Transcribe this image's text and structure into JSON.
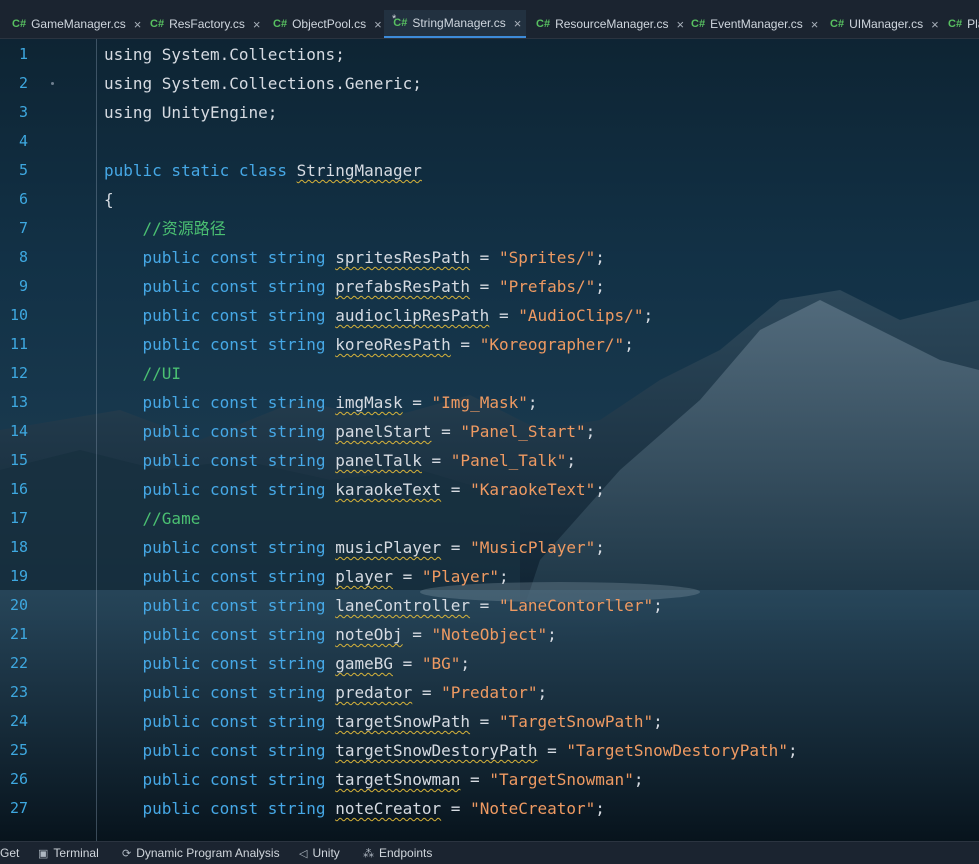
{
  "tabs": [
    {
      "label": "GameManager.cs",
      "lang": "C#",
      "active": false,
      "modified": false
    },
    {
      "label": "ResFactory.cs",
      "lang": "C#",
      "active": false,
      "modified": false
    },
    {
      "label": "ObjectPool.cs",
      "lang": "C#",
      "active": false,
      "modified": false
    },
    {
      "label": "StringManager.cs",
      "lang": "C#",
      "active": true,
      "modified": true
    },
    {
      "label": "ResourceManager.cs",
      "lang": "C#",
      "active": false,
      "modified": false
    },
    {
      "label": "EventManager.cs",
      "lang": "C#",
      "active": false,
      "modified": false
    },
    {
      "label": "UIManager.cs",
      "lang": "C#",
      "active": false,
      "modified": false
    },
    {
      "label": "Pla",
      "lang": "C#",
      "active": false,
      "modified": false
    }
  ],
  "tab_close_glyph": "×",
  "tab_modified_glyph": "*",
  "editor": {
    "lines": [
      {
        "n": "1",
        "tokens": [
          [
            "kw0",
            "using System.Collections;"
          ]
        ]
      },
      {
        "n": "2",
        "tokens": [
          [
            "pl",
            "using System.Collections.Generic;"
          ]
        ]
      },
      {
        "n": "3",
        "tokens": [
          [
            "pl",
            "using UnityEngine;"
          ]
        ]
      },
      {
        "n": "4",
        "tokens": []
      },
      {
        "n": "5",
        "tokens": [
          [
            "kw",
            "public static class "
          ],
          [
            "id",
            "StringManager"
          ]
        ]
      },
      {
        "n": "6",
        "tokens": [
          [
            "pl",
            "{"
          ]
        ]
      },
      {
        "n": "7",
        "tokens": [
          [
            "pl",
            "    "
          ],
          [
            "cm",
            "//资源路径"
          ]
        ]
      },
      {
        "n": "8",
        "tokens": [
          [
            "pl",
            "    "
          ],
          [
            "kw",
            "public const string "
          ],
          [
            "id",
            "spritesResPath"
          ],
          [
            "pl",
            " = "
          ],
          [
            "st",
            "\"Sprites/\""
          ],
          [
            "pl",
            ";"
          ]
        ]
      },
      {
        "n": "9",
        "tokens": [
          [
            "pl",
            "    "
          ],
          [
            "kw",
            "public const string "
          ],
          [
            "id",
            "prefabsResPath"
          ],
          [
            "pl",
            " = "
          ],
          [
            "st",
            "\"Prefabs/\""
          ],
          [
            "pl",
            ";"
          ]
        ]
      },
      {
        "n": "10",
        "tokens": [
          [
            "pl",
            "    "
          ],
          [
            "kw",
            "public const string "
          ],
          [
            "id",
            "audioclipResPath"
          ],
          [
            "pl",
            " = "
          ],
          [
            "st",
            "\"AudioClips/\""
          ],
          [
            "pl",
            ";"
          ]
        ]
      },
      {
        "n": "11",
        "tokens": [
          [
            "pl",
            "    "
          ],
          [
            "kw",
            "public const string "
          ],
          [
            "id",
            "koreoResPath"
          ],
          [
            "pl",
            " = "
          ],
          [
            "st",
            "\"Koreographer/\""
          ],
          [
            "pl",
            ";"
          ]
        ]
      },
      {
        "n": "12",
        "tokens": [
          [
            "pl",
            "    "
          ],
          [
            "cm",
            "//UI"
          ]
        ]
      },
      {
        "n": "13",
        "tokens": [
          [
            "pl",
            "    "
          ],
          [
            "kw",
            "public const string "
          ],
          [
            "id",
            "imgMask"
          ],
          [
            "pl",
            " = "
          ],
          [
            "st",
            "\"Img_Mask\""
          ],
          [
            "pl",
            ";"
          ]
        ]
      },
      {
        "n": "14",
        "tokens": [
          [
            "pl",
            "    "
          ],
          [
            "kw",
            "public const string "
          ],
          [
            "id",
            "panelStart"
          ],
          [
            "pl",
            " = "
          ],
          [
            "st",
            "\"Panel_Start\""
          ],
          [
            "pl",
            ";"
          ]
        ]
      },
      {
        "n": "15",
        "tokens": [
          [
            "pl",
            "    "
          ],
          [
            "kw",
            "public const string "
          ],
          [
            "id",
            "panelTalk"
          ],
          [
            "pl",
            " = "
          ],
          [
            "st",
            "\"Panel_Talk\""
          ],
          [
            "pl",
            ";"
          ]
        ]
      },
      {
        "n": "16",
        "tokens": [
          [
            "pl",
            "    "
          ],
          [
            "kw",
            "public const string "
          ],
          [
            "id",
            "karaokeText"
          ],
          [
            "pl",
            " = "
          ],
          [
            "st",
            "\"KaraokeText\""
          ],
          [
            "pl",
            ";"
          ]
        ]
      },
      {
        "n": "17",
        "tokens": [
          [
            "pl",
            "    "
          ],
          [
            "cm",
            "//Game"
          ]
        ]
      },
      {
        "n": "18",
        "tokens": [
          [
            "pl",
            "    "
          ],
          [
            "kw",
            "public const string "
          ],
          [
            "id",
            "musicPlayer"
          ],
          [
            "pl",
            " = "
          ],
          [
            "st",
            "\"MusicPlayer\""
          ],
          [
            "pl",
            ";"
          ]
        ]
      },
      {
        "n": "19",
        "tokens": [
          [
            "pl",
            "    "
          ],
          [
            "kw",
            "public const string "
          ],
          [
            "id",
            "player"
          ],
          [
            "pl",
            " = "
          ],
          [
            "st",
            "\"Player\""
          ],
          [
            "pl",
            ";"
          ]
        ]
      },
      {
        "n": "20",
        "tokens": [
          [
            "pl",
            "    "
          ],
          [
            "kw",
            "public const string "
          ],
          [
            "id",
            "laneController"
          ],
          [
            "pl",
            " = "
          ],
          [
            "st",
            "\"LaneContorller\""
          ],
          [
            "pl",
            ";"
          ]
        ]
      },
      {
        "n": "21",
        "tokens": [
          [
            "pl",
            "    "
          ],
          [
            "kw",
            "public const string "
          ],
          [
            "id",
            "noteObj"
          ],
          [
            "pl",
            " = "
          ],
          [
            "st",
            "\"NoteObject\""
          ],
          [
            "pl",
            ";"
          ]
        ]
      },
      {
        "n": "22",
        "tokens": [
          [
            "pl",
            "    "
          ],
          [
            "kw",
            "public const string "
          ],
          [
            "id",
            "gameBG"
          ],
          [
            "pl",
            " = "
          ],
          [
            "st",
            "\"BG\""
          ],
          [
            "pl",
            ";"
          ]
        ]
      },
      {
        "n": "23",
        "tokens": [
          [
            "pl",
            "    "
          ],
          [
            "kw",
            "public const string "
          ],
          [
            "id",
            "predator"
          ],
          [
            "pl",
            " = "
          ],
          [
            "st",
            "\"Predator\""
          ],
          [
            "pl",
            ";"
          ]
        ]
      },
      {
        "n": "24",
        "tokens": [
          [
            "pl",
            "    "
          ],
          [
            "kw",
            "public const string "
          ],
          [
            "id",
            "targetSnowPath"
          ],
          [
            "pl",
            " = "
          ],
          [
            "st",
            "\"TargetSnowPath\""
          ],
          [
            "pl",
            ";"
          ]
        ]
      },
      {
        "n": "25",
        "tokens": [
          [
            "pl",
            "    "
          ],
          [
            "kw",
            "public const string "
          ],
          [
            "id",
            "targetSnowDestoryPath"
          ],
          [
            "pl",
            " = "
          ],
          [
            "st",
            "\"TargetSnowDestoryPath\""
          ],
          [
            "pl",
            ";"
          ]
        ]
      },
      {
        "n": "26",
        "tokens": [
          [
            "pl",
            "    "
          ],
          [
            "kw",
            "public const string "
          ],
          [
            "id",
            "targetSnowman"
          ],
          [
            "pl",
            " = "
          ],
          [
            "st",
            "\"TargetSnowman\""
          ],
          [
            "pl",
            ";"
          ]
        ]
      },
      {
        "n": "27",
        "tokens": [
          [
            "pl",
            "    "
          ],
          [
            "kw",
            "public const string "
          ],
          [
            "id",
            "noteCreator"
          ],
          [
            "pl",
            " = "
          ],
          [
            "st",
            "\"NoteCreator\""
          ],
          [
            "pl",
            ";"
          ]
        ]
      }
    ]
  },
  "statusbar": {
    "items": [
      {
        "label": "Get",
        "icon": ""
      },
      {
        "label": "Terminal",
        "icon": "terminal-icon"
      },
      {
        "label": "Dynamic Program Analysis",
        "icon": "analysis-icon"
      },
      {
        "label": "Unity",
        "icon": "unity-icon"
      },
      {
        "label": "Endpoints",
        "icon": "endpoints-icon"
      }
    ]
  },
  "colors": {
    "keyword": "#46a8e6",
    "comment": "#4bc072",
    "string": "#ef9a62",
    "line_number": "#3ea8e0",
    "active_tab_underline": "#3d8bd9"
  }
}
